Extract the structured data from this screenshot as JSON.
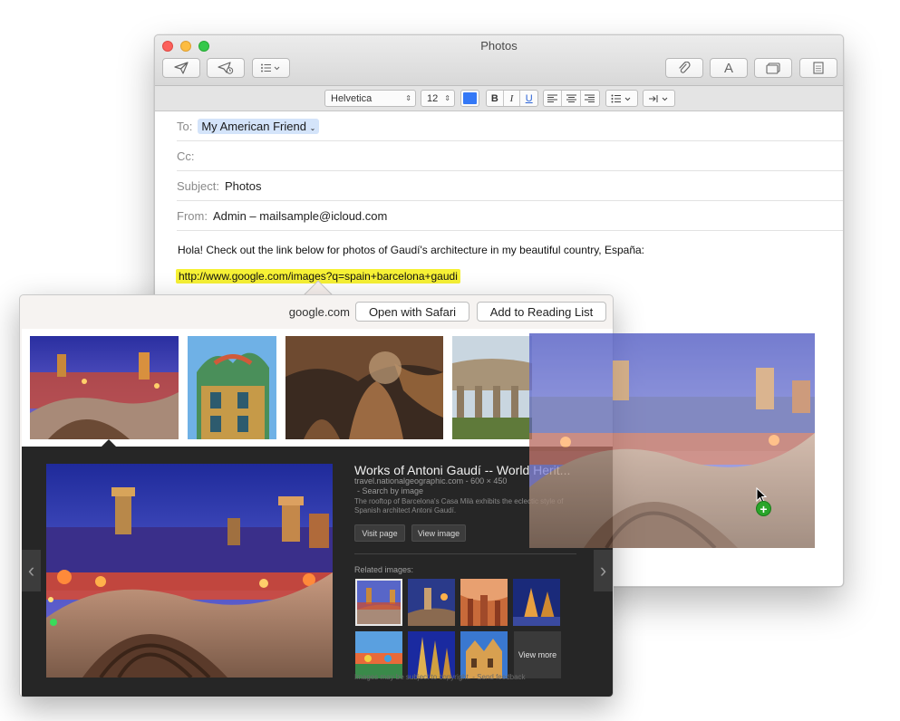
{
  "window": {
    "title": "Photos"
  },
  "toolbar": {
    "send_icon": "paper-plane-icon",
    "reply_icon": "paper-plane-clock-icon",
    "header_fields_icon": "list-icon",
    "attach_icon": "paperclip-icon",
    "format_label": "A",
    "photo_browser_icon": "photos-icon",
    "stationery_icon": "stationery-icon"
  },
  "format_bar": {
    "font": "Helvetica",
    "size": "12",
    "text_color": "#3478f6",
    "bold": "B",
    "italic": "I",
    "underline": "U"
  },
  "headers": {
    "to_label": "To:",
    "to_value": "My American Friend",
    "cc_label": "Cc:",
    "subject_label": "Subject:",
    "subject_value": "Photos",
    "from_label": "From:",
    "from_value": "Admin – mailsample@icloud.com"
  },
  "body": {
    "text": "Hola! Check out the link below for photos of Gaudí's architecture in my beautiful country, España:",
    "link": "http://www.google.com/images?q=spain+barcelona+gaudi"
  },
  "popover": {
    "domain": "google.com",
    "open_safari": "Open with Safari",
    "add_reading_list": "Add to Reading List"
  },
  "image_result": {
    "title": "Works of Antoni Gaudí -- World Herit...",
    "source": "travel.nationalgeographic.com - 600 × 450",
    "search_by_image": "- Search by image",
    "description": "The rooftop of Barcelona's Casa Milà exhibits the eclectic style of Spanish architect Antoni Gaudí.",
    "visit_page": "Visit page",
    "view_image": "View image",
    "related_label": "Related images:",
    "view_more": "View more",
    "copyright": "Images may be subject to copyright. - Send feedback"
  },
  "colors": {
    "link_highlight": "#f6f135",
    "to_token": "#d4e4fa",
    "dark_panel": "#262626"
  }
}
